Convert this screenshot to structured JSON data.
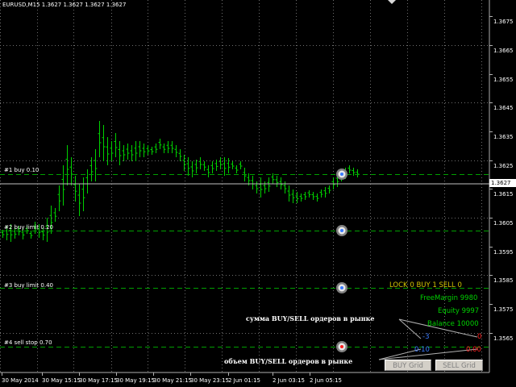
{
  "header": {
    "symbol_info": "EURUSD,M15  1.3627 1.3627 1.3627 1.3627"
  },
  "price_axis": {
    "labels": [
      "1.3675",
      "1.3665",
      "1.3655",
      "1.3645",
      "1.3635",
      "1.3625",
      "1.3615",
      "1.3605",
      "1.3595",
      "1.3585",
      "1.3575",
      "1.3565"
    ],
    "current_price": "1.3627"
  },
  "time_axis": {
    "labels": [
      "30 May 2014",
      "30 May 15:15",
      "30 May 17:15",
      "30 May 19:15",
      "30 May 21:15",
      "30 May 23:15",
      "2 Jun 01:15",
      "2 Jun 03:15",
      "2 Jun 05:15"
    ]
  },
  "orders": [
    {
      "label": "#1 buy 0.10"
    },
    {
      "label": "#2 buy limit 0.20"
    },
    {
      "label": "#3 buy limit 0.40"
    },
    {
      "label": "#4 sell stop 0.70"
    }
  ],
  "panel": {
    "lock_status": "LOCK 0  BUY 1  SELL 0",
    "free_margin": "FreeMargin 9980",
    "equity": "Equity 9997",
    "balance": "Balance 10000",
    "buy_sum": "-3",
    "sell_sum": "0",
    "buy_volume": "0.10",
    "sell_volume": "0.00",
    "buy_grid_button": "BUY Grid",
    "sell_grid_button": "SELL Grid"
  },
  "annotations": {
    "sum_orders": "сумма BUY/SELL ордеров в рынке",
    "volume_orders": "объем BUY/SELL ордеров в рынке"
  },
  "colors": {
    "background": "#000000",
    "candle": "#00d000",
    "order_line": "#00a000",
    "grid": "#6e6e6e",
    "panel_lock": "#d4c400",
    "panel_green": "#00d000",
    "buy_blue": "#3a7bff",
    "sell_red": "#ff2020"
  }
}
